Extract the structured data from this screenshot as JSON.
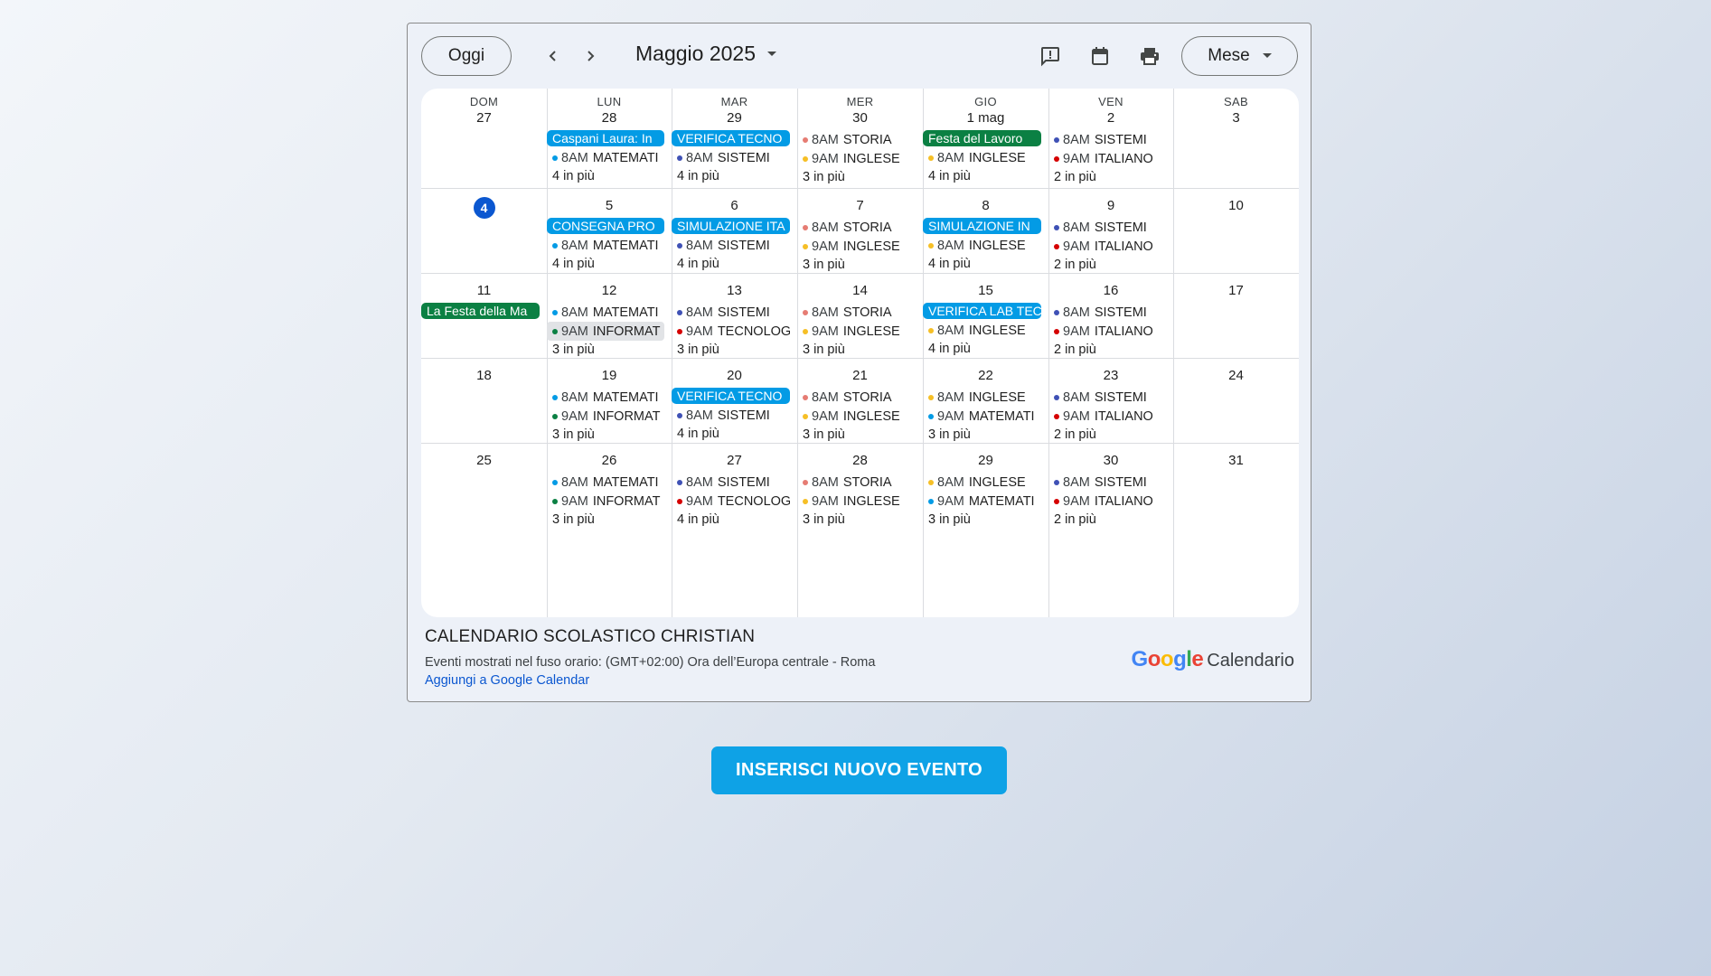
{
  "toolbar": {
    "today_label": "Oggi",
    "prev_icon": "chevron-left-icon",
    "next_icon": "chevron-right-icon",
    "month_title": "Maggio 2025",
    "view_label": "Mese",
    "icons": [
      "feedback-icon",
      "calendar-icon",
      "print-icon"
    ]
  },
  "weekdays": [
    "DOM",
    "LUN",
    "MAR",
    "MER",
    "GIO",
    "VEN",
    "SAB"
  ],
  "colors": {
    "chip_blue": "#039be5",
    "chip_green": "#0b8043",
    "dot_lightblue": "#039be5",
    "dot_indigo": "#3f51b5",
    "dot_salmon": "#e67c73",
    "dot_yellow": "#f6bf26",
    "dot_red": "#d50000",
    "dot_green": "#0b8043",
    "today_circle": "#0b57d0",
    "add_button": "#0ea2e6"
  },
  "weeks": [
    [
      {
        "day": "27",
        "items": []
      },
      {
        "day": "28",
        "items": [
          {
            "kind": "chip",
            "color": "blue",
            "text": "Caspani Laura: In"
          },
          {
            "kind": "event",
            "dot": "dot_lightblue",
            "time": "8AM",
            "title": "MATEMATI"
          },
          {
            "kind": "more",
            "text": "4 in più"
          }
        ]
      },
      {
        "day": "29",
        "items": [
          {
            "kind": "chip",
            "color": "blue",
            "text": "VERIFICA TECNO"
          },
          {
            "kind": "event",
            "dot": "dot_indigo",
            "time": "8AM",
            "title": "SISTEMI"
          },
          {
            "kind": "more",
            "text": "4 in più"
          }
        ]
      },
      {
        "day": "30",
        "items": [
          {
            "kind": "event",
            "dot": "dot_salmon",
            "time": "8AM",
            "title": "STORIA"
          },
          {
            "kind": "event",
            "dot": "dot_yellow",
            "time": "9AM",
            "title": "INGLESE"
          },
          {
            "kind": "more",
            "text": "3 in più"
          }
        ]
      },
      {
        "day": "1 mag",
        "items": [
          {
            "kind": "chip",
            "color": "green",
            "text": "Festa del Lavoro"
          },
          {
            "kind": "event",
            "dot": "dot_yellow",
            "time": "8AM",
            "title": "INGLESE"
          },
          {
            "kind": "more",
            "text": "4 in più"
          }
        ]
      },
      {
        "day": "2",
        "items": [
          {
            "kind": "event",
            "dot": "dot_indigo",
            "time": "8AM",
            "title": "SISTEMI"
          },
          {
            "kind": "event",
            "dot": "dot_red",
            "time": "9AM",
            "title": "ITALIANO"
          },
          {
            "kind": "more",
            "text": "2 in più"
          }
        ]
      },
      {
        "day": "3",
        "items": []
      }
    ],
    [
      {
        "day": "4",
        "today": true,
        "items": []
      },
      {
        "day": "5",
        "items": [
          {
            "kind": "chip",
            "color": "blue",
            "text": "CONSEGNA PRO"
          },
          {
            "kind": "event",
            "dot": "dot_lightblue",
            "time": "8AM",
            "title": "MATEMATI"
          },
          {
            "kind": "more",
            "text": "4 in più"
          }
        ]
      },
      {
        "day": "6",
        "items": [
          {
            "kind": "chip",
            "color": "blue",
            "text": "SIMULAZIONE ITA"
          },
          {
            "kind": "event",
            "dot": "dot_indigo",
            "time": "8AM",
            "title": "SISTEMI"
          },
          {
            "kind": "more",
            "text": "4 in più"
          }
        ]
      },
      {
        "day": "7",
        "items": [
          {
            "kind": "event",
            "dot": "dot_salmon",
            "time": "8AM",
            "title": "STORIA"
          },
          {
            "kind": "event",
            "dot": "dot_yellow",
            "time": "9AM",
            "title": "INGLESE"
          },
          {
            "kind": "more",
            "text": "3 in più"
          }
        ]
      },
      {
        "day": "8",
        "items": [
          {
            "kind": "chip",
            "color": "blue",
            "text": "SIMULAZIONE IN"
          },
          {
            "kind": "event",
            "dot": "dot_yellow",
            "time": "8AM",
            "title": "INGLESE"
          },
          {
            "kind": "more",
            "text": "4 in più"
          }
        ]
      },
      {
        "day": "9",
        "items": [
          {
            "kind": "event",
            "dot": "dot_indigo",
            "time": "8AM",
            "title": "SISTEMI"
          },
          {
            "kind": "event",
            "dot": "dot_red",
            "time": "9AM",
            "title": "ITALIANO"
          },
          {
            "kind": "more",
            "text": "2 in più"
          }
        ]
      },
      {
        "day": "10",
        "items": []
      }
    ],
    [
      {
        "day": "11",
        "items": [
          {
            "kind": "chip",
            "color": "green",
            "text": "La Festa della Ma"
          }
        ]
      },
      {
        "day": "12",
        "items": [
          {
            "kind": "event",
            "dot": "dot_lightblue",
            "time": "8AM",
            "title": "MATEMATI"
          },
          {
            "kind": "event",
            "dot": "dot_green",
            "time": "9AM",
            "title": "INFORMAT",
            "highlight": true
          },
          {
            "kind": "more",
            "text": "3 in più"
          }
        ]
      },
      {
        "day": "13",
        "items": [
          {
            "kind": "event",
            "dot": "dot_indigo",
            "time": "8AM",
            "title": "SISTEMI"
          },
          {
            "kind": "event",
            "dot": "dot_red",
            "time": "9AM",
            "title": "TECNOLOG"
          },
          {
            "kind": "more",
            "text": "3 in più"
          }
        ]
      },
      {
        "day": "14",
        "items": [
          {
            "kind": "event",
            "dot": "dot_salmon",
            "time": "8AM",
            "title": "STORIA"
          },
          {
            "kind": "event",
            "dot": "dot_yellow",
            "time": "9AM",
            "title": "INGLESE"
          },
          {
            "kind": "more",
            "text": "3 in più"
          }
        ]
      },
      {
        "day": "15",
        "items": [
          {
            "kind": "chip",
            "color": "blue",
            "text": "VERIFICA LAB TEC"
          },
          {
            "kind": "event",
            "dot": "dot_yellow",
            "time": "8AM",
            "title": "INGLESE"
          },
          {
            "kind": "more",
            "text": "4 in più"
          }
        ]
      },
      {
        "day": "16",
        "items": [
          {
            "kind": "event",
            "dot": "dot_indigo",
            "time": "8AM",
            "title": "SISTEMI"
          },
          {
            "kind": "event",
            "dot": "dot_red",
            "time": "9AM",
            "title": "ITALIANO"
          },
          {
            "kind": "more",
            "text": "2 in più"
          }
        ]
      },
      {
        "day": "17",
        "items": []
      }
    ],
    [
      {
        "day": "18",
        "items": []
      },
      {
        "day": "19",
        "items": [
          {
            "kind": "event",
            "dot": "dot_lightblue",
            "time": "8AM",
            "title": "MATEMATI"
          },
          {
            "kind": "event",
            "dot": "dot_green",
            "time": "9AM",
            "title": "INFORMAT"
          },
          {
            "kind": "more",
            "text": "3 in più"
          }
        ]
      },
      {
        "day": "20",
        "items": [
          {
            "kind": "chip",
            "color": "blue",
            "text": "VERIFICA TECNO"
          },
          {
            "kind": "event",
            "dot": "dot_indigo",
            "time": "8AM",
            "title": "SISTEMI"
          },
          {
            "kind": "more",
            "text": "4 in più"
          }
        ]
      },
      {
        "day": "21",
        "items": [
          {
            "kind": "event",
            "dot": "dot_salmon",
            "time": "8AM",
            "title": "STORIA"
          },
          {
            "kind": "event",
            "dot": "dot_yellow",
            "time": "9AM",
            "title": "INGLESE"
          },
          {
            "kind": "more",
            "text": "3 in più"
          }
        ]
      },
      {
        "day": "22",
        "items": [
          {
            "kind": "event",
            "dot": "dot_yellow",
            "time": "8AM",
            "title": "INGLESE"
          },
          {
            "kind": "event",
            "dot": "dot_lightblue",
            "time": "9AM",
            "title": "MATEMATI"
          },
          {
            "kind": "more",
            "text": "3 in più"
          }
        ]
      },
      {
        "day": "23",
        "items": [
          {
            "kind": "event",
            "dot": "dot_indigo",
            "time": "8AM",
            "title": "SISTEMI"
          },
          {
            "kind": "event",
            "dot": "dot_red",
            "time": "9AM",
            "title": "ITALIANO"
          },
          {
            "kind": "more",
            "text": "2 in più"
          }
        ]
      },
      {
        "day": "24",
        "items": []
      }
    ],
    [
      {
        "day": "25",
        "items": []
      },
      {
        "day": "26",
        "items": [
          {
            "kind": "event",
            "dot": "dot_lightblue",
            "time": "8AM",
            "title": "MATEMATI"
          },
          {
            "kind": "event",
            "dot": "dot_green",
            "time": "9AM",
            "title": "INFORMAT"
          },
          {
            "kind": "more",
            "text": "3 in più"
          }
        ]
      },
      {
        "day": "27",
        "items": [
          {
            "kind": "event",
            "dot": "dot_indigo",
            "time": "8AM",
            "title": "SISTEMI"
          },
          {
            "kind": "event",
            "dot": "dot_red",
            "time": "9AM",
            "title": "TECNOLOG"
          },
          {
            "kind": "more",
            "text": "4 in più"
          }
        ]
      },
      {
        "day": "28",
        "items": [
          {
            "kind": "event",
            "dot": "dot_salmon",
            "time": "8AM",
            "title": "STORIA"
          },
          {
            "kind": "event",
            "dot": "dot_yellow",
            "time": "9AM",
            "title": "INGLESE"
          },
          {
            "kind": "more",
            "text": "3 in più"
          }
        ]
      },
      {
        "day": "29",
        "items": [
          {
            "kind": "event",
            "dot": "dot_yellow",
            "time": "8AM",
            "title": "INGLESE"
          },
          {
            "kind": "event",
            "dot": "dot_lightblue",
            "time": "9AM",
            "title": "MATEMATI"
          },
          {
            "kind": "more",
            "text": "3 in più"
          }
        ]
      },
      {
        "day": "30",
        "items": [
          {
            "kind": "event",
            "dot": "dot_indigo",
            "time": "8AM",
            "title": "SISTEMI"
          },
          {
            "kind": "event",
            "dot": "dot_red",
            "time": "9AM",
            "title": "ITALIANO"
          },
          {
            "kind": "more",
            "text": "2 in più"
          }
        ]
      },
      {
        "day": "31",
        "items": []
      }
    ]
  ],
  "footer": {
    "calendar_title": "CALENDARIO SCOLASTICO CHRISTIAN",
    "timezone": "Eventi mostrati nel fuso orario: (GMT+02:00) Ora dell’Europa centrale - Roma",
    "add_link": "Aggiungi a Google Calendar",
    "brand_logo": "Google",
    "brand_text": "Calendario"
  },
  "add_event_button": "INSERISCI NUOVO EVENTO"
}
